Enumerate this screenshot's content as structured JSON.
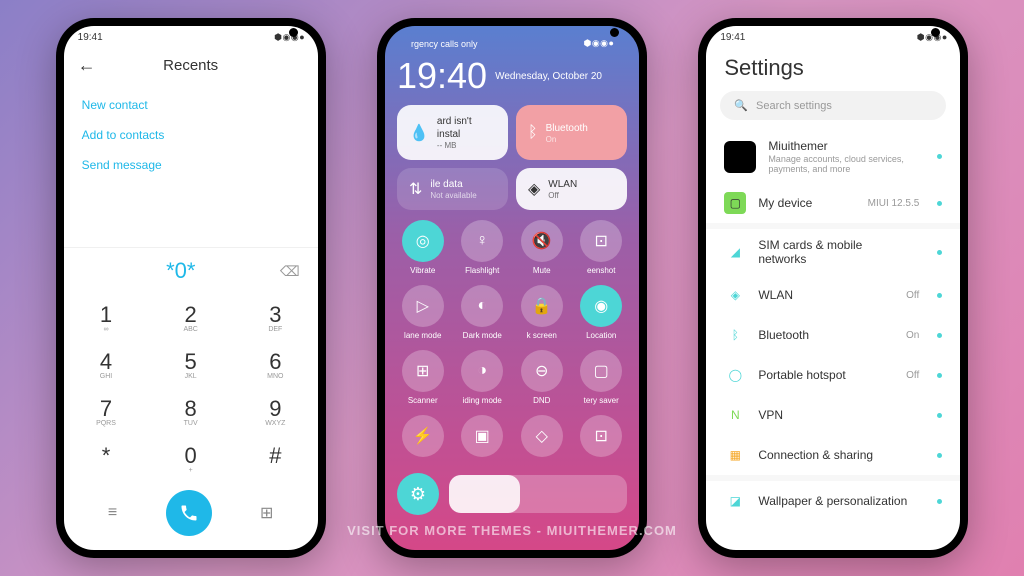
{
  "status": {
    "time": "19:41",
    "icons": "⬢ ◉ ◉ ●"
  },
  "watermark": "VISIT FOR MORE THEMES - MIUITHEMER.COM",
  "dialer": {
    "title": "Recents",
    "links": [
      "New contact",
      "Add to contacts",
      "Send message"
    ],
    "input": "*0*",
    "keys": [
      {
        "n": "1",
        "s": "∞"
      },
      {
        "n": "2",
        "s": "ABC"
      },
      {
        "n": "3",
        "s": "DEF"
      },
      {
        "n": "4",
        "s": "GHI"
      },
      {
        "n": "5",
        "s": "JKL"
      },
      {
        "n": "6",
        "s": "MNO"
      },
      {
        "n": "7",
        "s": "PQRS"
      },
      {
        "n": "8",
        "s": "TUV"
      },
      {
        "n": "9",
        "s": "WXYZ"
      },
      {
        "n": "*",
        "s": ""
      },
      {
        "n": "0",
        "s": "+"
      },
      {
        "n": "#",
        "s": ""
      }
    ]
  },
  "cc": {
    "statusText": "rgency calls only",
    "clock": "19:40",
    "date": "Wednesday, October 20",
    "widgets": [
      {
        "title": "ard isn't instal",
        "sub": "-- MB",
        "style": "white",
        "icon": "💧"
      },
      {
        "title": "Bluetooth",
        "sub": "On",
        "style": "pink",
        "icon": "ᛒ"
      },
      {
        "title": "ile data",
        "sub": "Not available",
        "style": "dim",
        "icon": "⇅"
      },
      {
        "title": "WLAN",
        "sub": "Off",
        "style": "white",
        "icon": "◈"
      }
    ],
    "toggles": [
      {
        "label": "Vibrate",
        "icon": "◎",
        "active": true
      },
      {
        "label": "Flashlight",
        "icon": "♀",
        "active": false
      },
      {
        "label": "Mute",
        "icon": "🔇",
        "active": false
      },
      {
        "label": "eenshot",
        "icon": "⊡",
        "active": false
      },
      {
        "label": "lane mode",
        "icon": "▷",
        "active": false
      },
      {
        "label": "Dark mode",
        "icon": "◐",
        "active": false
      },
      {
        "label": "k screen",
        "icon": "🔒",
        "active": false
      },
      {
        "label": "Location",
        "icon": "◉",
        "active": true
      },
      {
        "label": "Scanner",
        "icon": "⊞",
        "active": false
      },
      {
        "label": "iding mode",
        "icon": "◑",
        "active": false
      },
      {
        "label": "DND",
        "icon": "⊖",
        "active": false
      },
      {
        "label": "tery saver",
        "icon": "▢",
        "active": false
      },
      {
        "label": "",
        "icon": "⚡",
        "active": false
      },
      {
        "label": "",
        "icon": "▣",
        "active": false
      },
      {
        "label": "",
        "icon": "◇",
        "active": false
      },
      {
        "label": "",
        "icon": "⊡",
        "active": false
      }
    ]
  },
  "settings": {
    "title": "Settings",
    "searchPlaceholder": "Search settings",
    "account": {
      "name": "Miuithemer",
      "desc": "Manage accounts, cloud services, payments, and more"
    },
    "device": {
      "label": "My device",
      "val": "MIUI 12.5.5",
      "color": "#7ED957"
    },
    "rows": [
      {
        "label": "SIM cards & mobile networks",
        "val": "",
        "icon": "◢",
        "color": "#4DD6D6"
      },
      {
        "label": "WLAN",
        "val": "Off",
        "icon": "◈",
        "color": "#4DD6D6"
      },
      {
        "label": "Bluetooth",
        "val": "On",
        "icon": "ᛒ",
        "color": "#4DD6D6"
      },
      {
        "label": "Portable hotspot",
        "val": "Off",
        "icon": "◯",
        "color": "#4DD6D6"
      },
      {
        "label": "VPN",
        "val": "",
        "icon": "N",
        "color": "#7ED957"
      },
      {
        "label": "Connection & sharing",
        "val": "",
        "icon": "▦",
        "color": "#F5A623"
      }
    ],
    "rows2": [
      {
        "label": "Wallpaper & personalization",
        "val": "",
        "icon": "◪",
        "color": "#4DD6D6"
      }
    ]
  }
}
